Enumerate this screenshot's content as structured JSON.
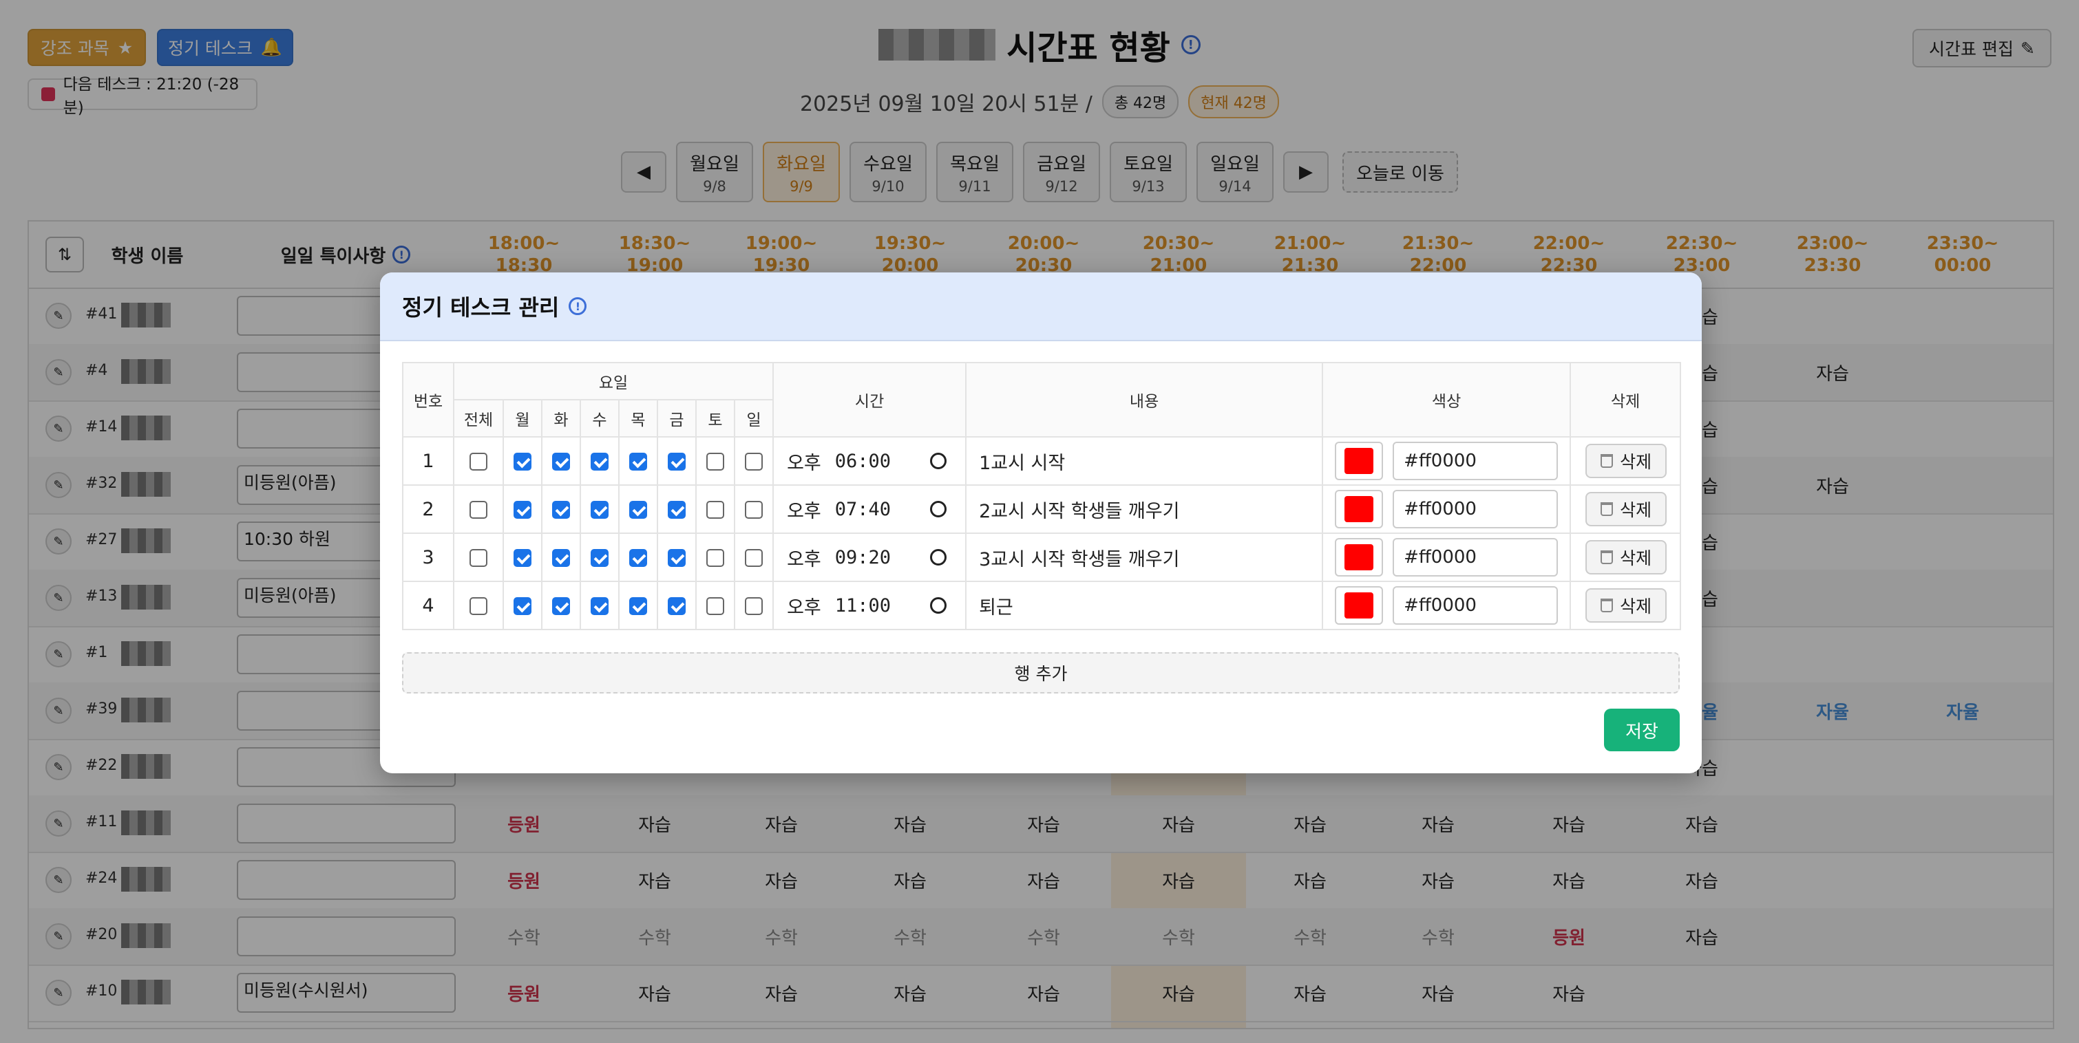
{
  "header": {
    "highlight_btn": "강조 과목",
    "highlight_icon": "star-icon",
    "recurring_btn": "정기 테스크",
    "recurring_icon": "bell-icon",
    "next_task": "다음 테스크 : 21:20 (-28분)",
    "title": "시간표 현황",
    "datetime": "2025년 09월 10일 20시 51분 /",
    "total": "총 42명",
    "current": "현재 42명",
    "edit_btn": "시간표 편집"
  },
  "days": [
    {
      "label": "월요일",
      "date": "9/8",
      "active": false
    },
    {
      "label": "화요일",
      "date": "9/9",
      "active": true
    },
    {
      "label": "수요일",
      "date": "9/10",
      "active": false
    },
    {
      "label": "목요일",
      "date": "9/11",
      "active": false
    },
    {
      "label": "금요일",
      "date": "9/12",
      "active": false
    },
    {
      "label": "토요일",
      "date": "9/13",
      "active": false
    },
    {
      "label": "일요일",
      "date": "9/14",
      "active": false
    }
  ],
  "today_btn": "오늘로 이동",
  "timetable": {
    "student_col": "학생 이름",
    "note_col": "일일 특이사항",
    "slots": [
      [
        "18:00~",
        "18:30"
      ],
      [
        "18:30~",
        "19:00"
      ],
      [
        "19:00~",
        "19:30"
      ],
      [
        "19:30~",
        "20:00"
      ],
      [
        "20:00~",
        "20:30"
      ],
      [
        "20:30~",
        "21:00"
      ],
      [
        "21:00~",
        "21:30"
      ],
      [
        "21:30~",
        "22:00"
      ],
      [
        "22:00~",
        "22:30"
      ],
      [
        "22:30~",
        "23:00"
      ],
      [
        "23:00~",
        "23:30"
      ],
      [
        "23:30~",
        "00:00"
      ]
    ],
    "rows": [
      {
        "num": "#41",
        "note": "",
        "cells": [
          "",
          "",
          "",
          "",
          "",
          "",
          "",
          "",
          "",
          "자습",
          "",
          ""
        ]
      },
      {
        "num": "#4",
        "note": "",
        "cells": [
          "",
          "",
          "",
          "",
          "",
          "",
          "",
          "",
          "",
          "자습",
          "자습",
          ""
        ]
      },
      {
        "num": "#14",
        "note": "",
        "cells": [
          "",
          "",
          "",
          "",
          "",
          "",
          "",
          "",
          "",
          "자습",
          "",
          ""
        ]
      },
      {
        "num": "#32",
        "note": "미등원(아픔)",
        "cells": [
          "",
          "",
          "",
          "",
          "",
          "",
          "",
          "",
          "",
          "자습",
          "자습",
          ""
        ]
      },
      {
        "num": "#27",
        "note": "10:30 하원",
        "cells": [
          "",
          "",
          "",
          "",
          "",
          "",
          "",
          "",
          "",
          "자습",
          "",
          ""
        ]
      },
      {
        "num": "#13",
        "note": "미등원(아픔)",
        "cells": [
          "",
          "",
          "",
          "",
          "",
          "",
          "",
          "",
          "",
          "자습",
          "",
          ""
        ]
      },
      {
        "num": "#1",
        "note": "",
        "cells": [
          "",
          "",
          "",
          "",
          "",
          "",
          "",
          "",
          "",
          "",
          "",
          ""
        ]
      },
      {
        "num": "#39",
        "note": "",
        "cells": [
          "",
          "",
          "",
          "",
          "",
          "",
          "",
          "",
          "",
          "자율",
          "자율",
          "자율"
        ]
      },
      {
        "num": "#22",
        "note": "",
        "cells": [
          "",
          "",
          "",
          "",
          "",
          "",
          "",
          "",
          "",
          "자습",
          "",
          ""
        ]
      },
      {
        "num": "#11",
        "note": "",
        "cells": [
          "등원",
          "자습",
          "자습",
          "자습",
          "자습",
          "자습",
          "자습",
          "자습",
          "자습",
          "자습",
          "",
          ""
        ]
      },
      {
        "num": "#24",
        "note": "",
        "cells": [
          "등원",
          "자습",
          "자습",
          "자습",
          "자습",
          "자습",
          "자습",
          "자습",
          "자습",
          "자습",
          "",
          ""
        ]
      },
      {
        "num": "#20",
        "note": "",
        "cells": [
          "수학",
          "수학",
          "수학",
          "수학",
          "수학",
          "수학",
          "수학",
          "수학",
          "등원",
          "자습",
          "",
          ""
        ]
      },
      {
        "num": "#10",
        "note": "미등원(수시원서)",
        "cells": [
          "등원",
          "자습",
          "자습",
          "자습",
          "자습",
          "자습",
          "자습",
          "자습",
          "자습",
          "",
          "",
          ""
        ]
      }
    ]
  },
  "modal": {
    "title": "정기 테스크 관리",
    "col_num": "번호",
    "col_days": "요일",
    "col_time": "시간",
    "col_content": "내용",
    "col_color": "색상",
    "col_delete": "삭제",
    "day_headers": [
      "전체",
      "월",
      "화",
      "수",
      "목",
      "금",
      "토",
      "일"
    ],
    "tasks": [
      {
        "num": "1",
        "checks": [
          false,
          true,
          true,
          true,
          true,
          true,
          false,
          false
        ],
        "ampm": "오후",
        "time": "06:00",
        "content": "1교시 시작",
        "color": "#ff0000",
        "delete": "삭제"
      },
      {
        "num": "2",
        "checks": [
          false,
          true,
          true,
          true,
          true,
          true,
          false,
          false
        ],
        "ampm": "오후",
        "time": "07:40",
        "content": "2교시 시작 학생들 깨우기",
        "color": "#ff0000",
        "delete": "삭제"
      },
      {
        "num": "3",
        "checks": [
          false,
          true,
          true,
          true,
          true,
          true,
          false,
          false
        ],
        "ampm": "오후",
        "time": "09:20",
        "content": "3교시 시작 학생들 깨우기",
        "color": "#ff0000",
        "delete": "삭제"
      },
      {
        "num": "4",
        "checks": [
          false,
          true,
          true,
          true,
          true,
          true,
          false,
          false
        ],
        "ampm": "오후",
        "time": "11:00",
        "content": "퇴근",
        "color": "#ff0000",
        "delete": "삭제"
      }
    ],
    "add_row": "행 추가",
    "save": "저장"
  }
}
